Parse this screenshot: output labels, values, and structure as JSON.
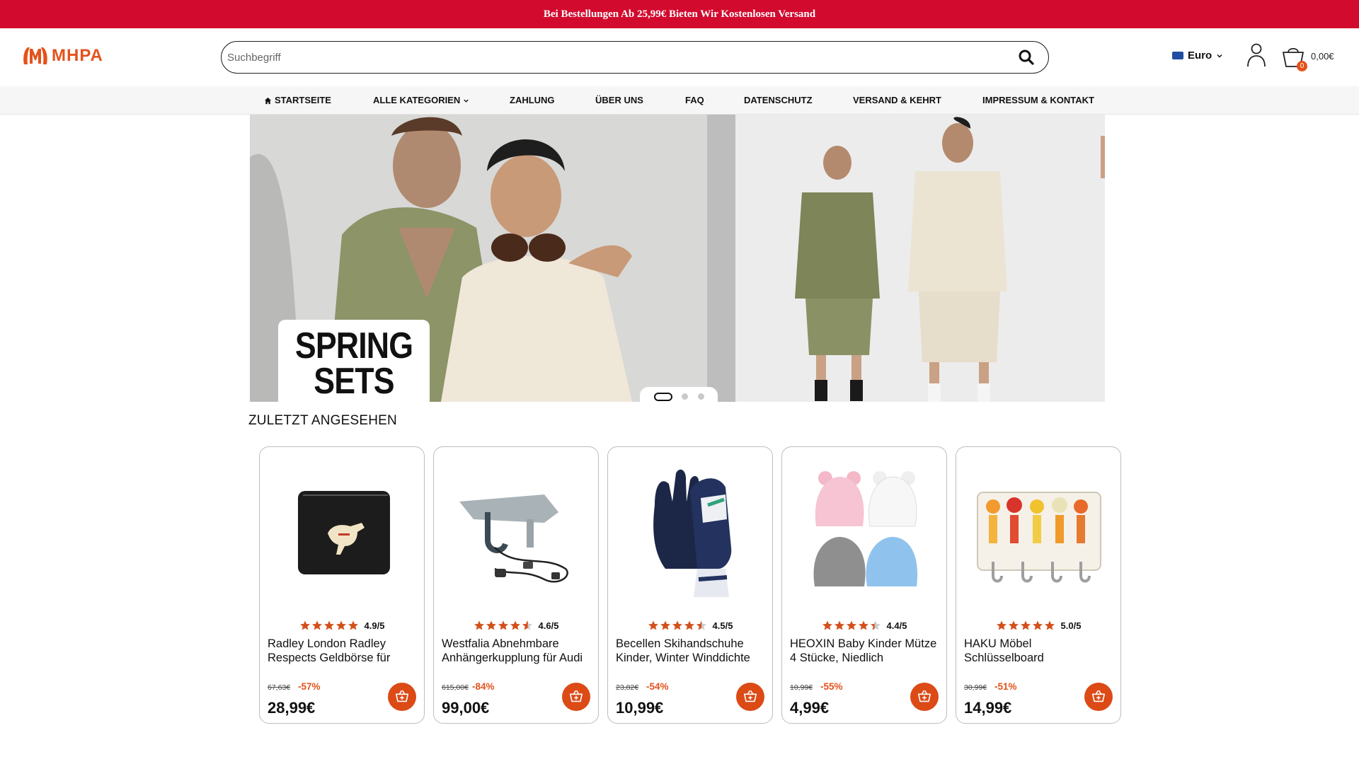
{
  "promo": {
    "text": "Bei Bestellungen Ab 25,99€ Bieten Wir Kostenlosen Versand"
  },
  "header": {
    "logo_text": "MHPA",
    "search_placeholder": "Suchbegriff",
    "currency": "Euro",
    "cart_count": "0",
    "cart_total": "0,00€"
  },
  "nav": {
    "items": [
      {
        "label": "STARTSEITE"
      },
      {
        "label": "ALLE KATEGORIEN"
      },
      {
        "label": "ZAHLUNG"
      },
      {
        "label": "ÜBER UNS"
      },
      {
        "label": "FAQ"
      },
      {
        "label": "DATENSCHUTZ"
      },
      {
        "label": "VERSAND & KEHRT"
      },
      {
        "label": "IMPRESSUM & KONTAKT"
      }
    ]
  },
  "hero": {
    "label_line1": "SPRING",
    "label_line2": "SETS",
    "slide_count": 3,
    "active_slide": 1
  },
  "recently_viewed": {
    "title": "ZULETZT ANGESEHEN",
    "products": [
      {
        "title": "Radley London Radley Respects Geldbörse für",
        "rating": 4.9,
        "rating_text": "4.9/5",
        "old_price": "67,63€",
        "discount": "-57%",
        "price": "28,99€",
        "image": "black-wallet-with-dog-emblem"
      },
      {
        "title": "Westfalia Abnehmbare Anhängerkupplung für Audi",
        "rating": 4.6,
        "rating_text": "4.6/5",
        "old_price": "615,00€",
        "discount": "-84%",
        "price": "99,00€",
        "image": "tow-hitch-with-wiring-kit"
      },
      {
        "title": "Becellen Skihandschuhe Kinder, Winter Winddichte",
        "rating": 4.5,
        "rating_text": "4.5/5",
        "old_price": "23,82€",
        "discount": "-54%",
        "price": "10,99€",
        "image": "navy-ski-gloves"
      },
      {
        "title": "HEOXIN Baby Kinder Mütze 4 Stücke, Niedlich",
        "rating": 4.4,
        "rating_text": "4.4/5",
        "old_price": "10,99€",
        "discount": "-55%",
        "price": "4,99€",
        "image": "four-baby-beanies"
      },
      {
        "title": "HAKU Möbel Schlüsselboard",
        "rating": 5.0,
        "rating_text": "5.0/5",
        "old_price": "30,99€",
        "discount": "-51%",
        "price": "14,99€",
        "image": "key-rack-with-juice-print"
      }
    ]
  },
  "colors": {
    "promo_bg": "#d20a2e",
    "accent": "#e4521b",
    "star": "#d3501b",
    "nav_bg": "#f6f6f6"
  },
  "icons": [
    "home-icon",
    "chevron-down-icon",
    "search-icon",
    "user-icon",
    "cart-icon",
    "cart-add-icon",
    "star-icon"
  ]
}
